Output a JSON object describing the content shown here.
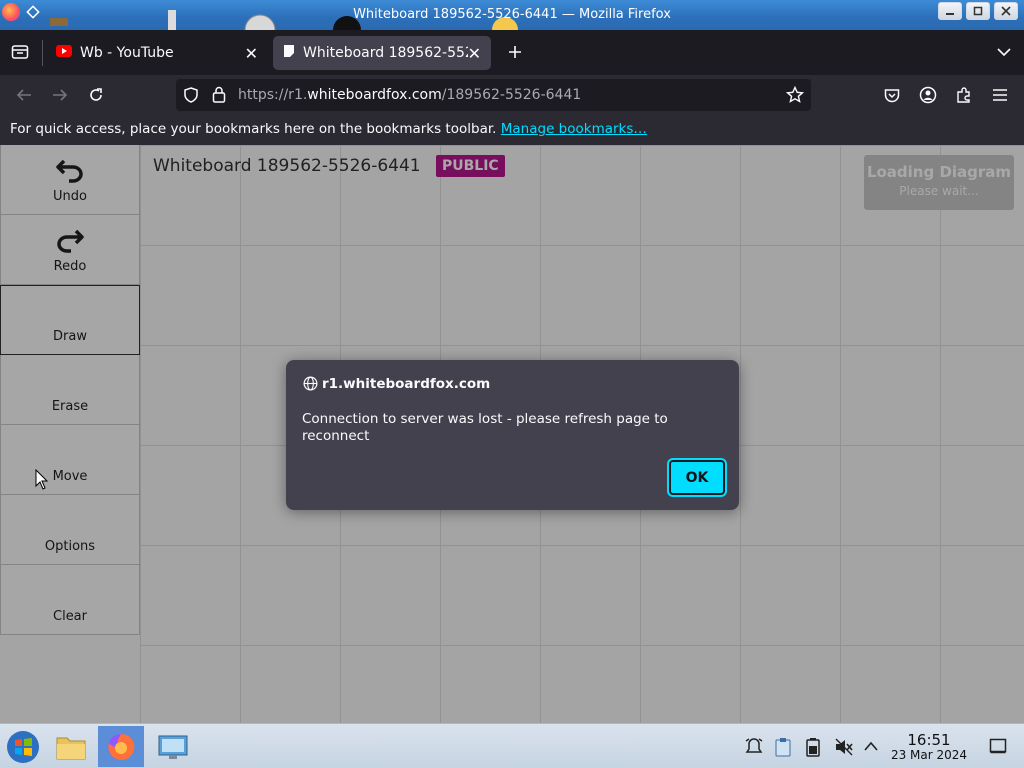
{
  "window": {
    "title": "Whiteboard 189562-5526-6441 — Mozilla Firefox"
  },
  "tabs": [
    {
      "label": "Wb - YouTube",
      "icon": "youtube-icon",
      "active": false
    },
    {
      "label": "Whiteboard 189562-5526-6441",
      "icon": "whiteboard-icon",
      "active": true
    }
  ],
  "address_bar": {
    "url_prefix": "https://r1.",
    "url_host": "whiteboardfox.com",
    "url_path": "/189562-5526-6441"
  },
  "bookmarks_bar": {
    "message": "For quick access, place your bookmarks here on the bookmarks toolbar.",
    "link": "Manage bookmarks…"
  },
  "whiteboard": {
    "title": "Whiteboard 189562-5526-6441",
    "badge": "PUBLIC",
    "badge_color": "#b5178f",
    "loading_title": "Loading Diagram",
    "loading_sub": "Please wait..."
  },
  "tools": [
    {
      "label": "Undo",
      "icon": "undo-icon"
    },
    {
      "label": "Redo",
      "icon": "redo-icon"
    },
    {
      "label": "Draw",
      "icon": ""
    },
    {
      "label": "Erase",
      "icon": ""
    },
    {
      "label": "Move",
      "icon": ""
    },
    {
      "label": "Options",
      "icon": ""
    },
    {
      "label": "Clear",
      "icon": ""
    }
  ],
  "dialog": {
    "origin": "r1.whiteboardfox.com",
    "message": "Connection to server was lost - please refresh page to reconnect",
    "ok_label": "OK",
    "accent": "#00ddff"
  },
  "taskbar": {
    "time": "16:51",
    "date": "23 Mar 2024"
  }
}
